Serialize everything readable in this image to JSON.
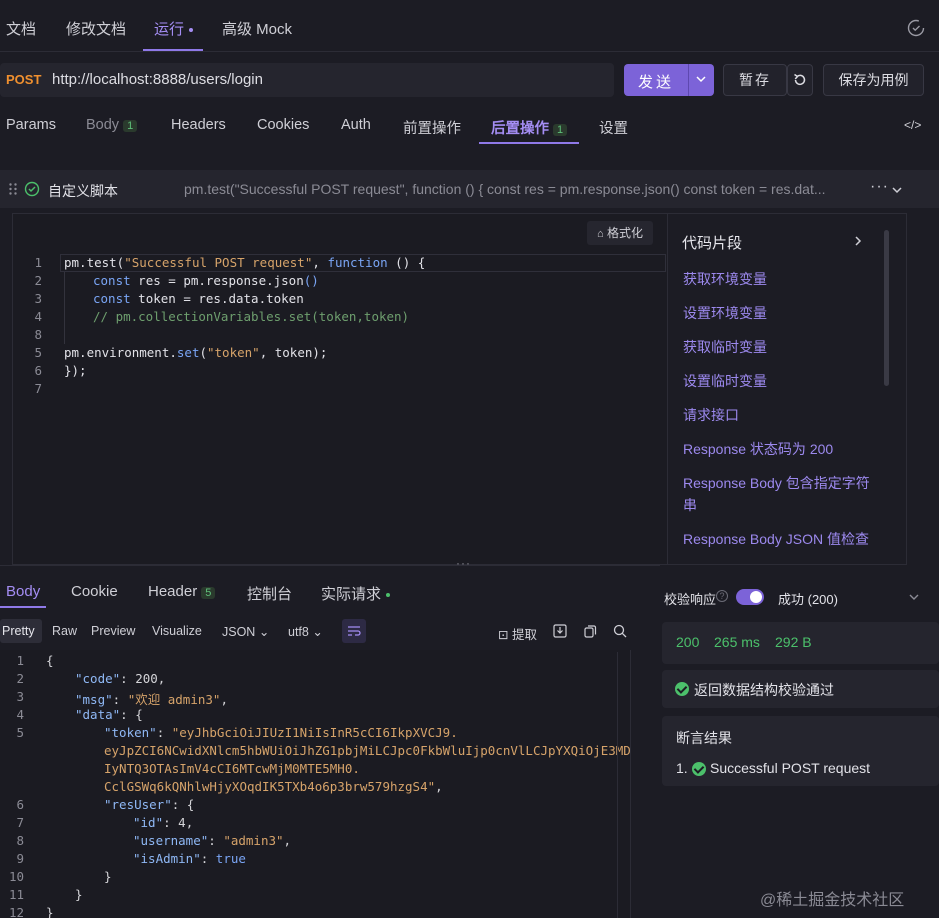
{
  "top_tabs": {
    "docs": "文档",
    "edit_docs": "修改文档",
    "run": "运行",
    "mock": "高级 Mock"
  },
  "request": {
    "method": "POST",
    "url": "http://localhost:8888/users/login",
    "send_label": "发送",
    "save_label": "暂存",
    "save_as_case_label": "保存为用例"
  },
  "request_tabs": {
    "params": "Params",
    "body": "Body",
    "body_count": "1",
    "headers": "Headers",
    "cookies": "Cookies",
    "auth": "Auth",
    "pre_ops": "前置操作",
    "post_ops": "后置操作",
    "post_ops_count": "1",
    "settings": "设置"
  },
  "script": {
    "title": "自定义脚本",
    "preview": "pm.test(\"Successful POST request\", function () { const res = pm.response.json() const token = res.dat...",
    "format_label": "格式化",
    "line_numbers": [
      "1",
      "2",
      "3",
      "4",
      "5",
      "6",
      "7",
      "8"
    ],
    "code": {
      "l1_a": "pm.test(",
      "l1_str": "\"Successful POST request\"",
      "l1_b": ", ",
      "l1_kw": "function",
      "l1_c": " () {",
      "l2_kw": "const",
      "l2_rest": " res = pm.response.json",
      "l2_paren": "()",
      "l3_kw": "const",
      "l3_rest": " token = res.data.token",
      "l4_comment": "// pm.collectionVariables.set(token,token)",
      "l6_a": "pm.environment.",
      "l6_set": "set",
      "l6_b": "(",
      "l6_str": "\"token\"",
      "l6_c": ", token);",
      "l7": "});"
    }
  },
  "snippets": {
    "title": "代码片段",
    "items": [
      "获取环境变量",
      "设置环境变量",
      "获取临时变量",
      "设置临时变量",
      "请求接口",
      "Response 状态码为 200",
      "Response Body 包含指定字符串",
      "Response Body JSON 值检查"
    ]
  },
  "response_tabs": {
    "body": "Body",
    "cookie": "Cookie",
    "header": "Header",
    "header_count": "5",
    "console": "控制台",
    "actual_request": "实际请求"
  },
  "format_tabs": {
    "pretty": "Pretty",
    "raw": "Raw",
    "preview": "Preview",
    "visualize": "Visualize",
    "json": "JSON",
    "utf8": "utf8",
    "extract": "提取"
  },
  "response_json": {
    "line_numbers": [
      "1",
      "2",
      "3",
      "4",
      "5",
      "6",
      "7",
      "8",
      "9",
      "10",
      "11",
      "12"
    ],
    "code_key": "\"code\"",
    "code_val": "200",
    "msg_key": "\"msg\"",
    "msg_val": "\"欢迎 admin3\"",
    "data_key": "\"data\"",
    "token_key": "\"token\"",
    "token_l1": "\"eyJhbGciOiJIUzI1NiIsInR5cCI6IkpXVCJ9.",
    "token_l2": "eyJpZCI6NCwidXNlcm5hbWUiOiJhZG1pbjMiLCJpc0FkbWluIjp0cnVlLCJpYXQiOjE3MD",
    "token_l3": "IyNTQ3OTAsImV4cCI6MTcwMjM0MTE5MH0.",
    "token_l4": "CclGSWq6kQNhlwHjyXOqdIK5TXb4o6p3brw579hzgS4\"",
    "resuser_key": "\"resUser\"",
    "id_key": "\"id\"",
    "id_val": "4",
    "username_key": "\"username\"",
    "username_val": "\"admin3\"",
    "isadmin_key": "\"isAdmin\"",
    "isadmin_val": "true"
  },
  "validation": {
    "label": "校验响应",
    "status_option": "成功 (200)",
    "status_code": "200",
    "time": "265 ms",
    "size": "292 B",
    "schema_pass": "返回数据结构校验通过",
    "assert_title": "断言结果",
    "assert_item_num": "1.",
    "assert_item": "Successful POST request"
  },
  "watermark": "@稀土掘金技术社区"
}
